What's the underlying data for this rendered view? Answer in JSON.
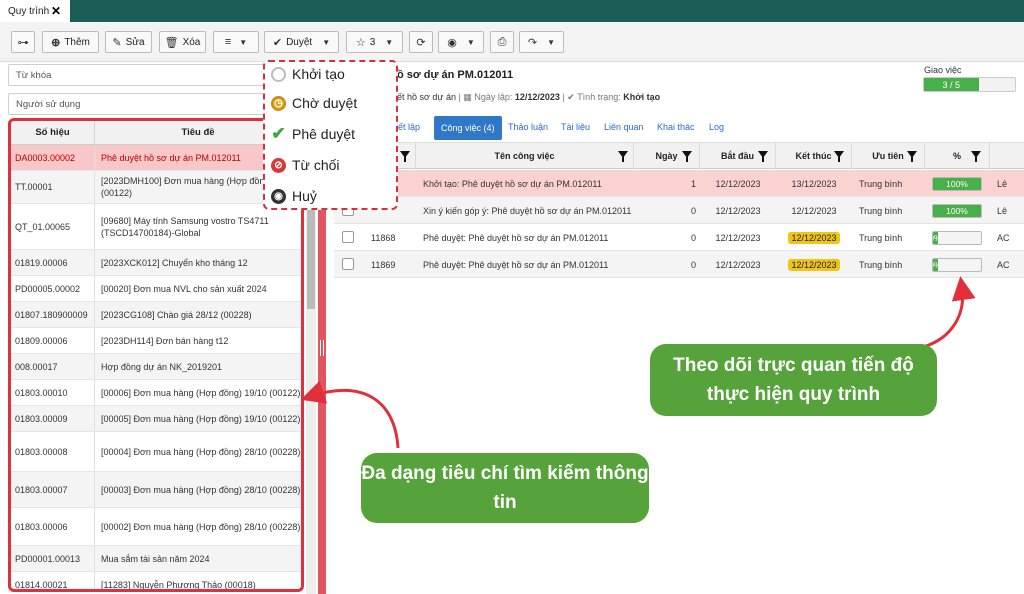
{
  "window": {
    "tab_label": "Quy trình",
    "close_glyph": "✕"
  },
  "toolbar": {
    "search_icon": "binoculars-icon",
    "add_label": "Thêm",
    "edit_label": "Sửa",
    "delete_label": "Xóa",
    "approve_label": "Duyệt",
    "star_count": "3"
  },
  "filters": {
    "keyword_placeholder": "Từ khóa",
    "user_placeholder": "Người sử dụng"
  },
  "left_table": {
    "headers": [
      "Số hiệu",
      "Tiêu đề"
    ],
    "rows": [
      {
        "id": "DA0003.00002",
        "title": "Phê duyệt hồ sơ dự án PM.012011"
      },
      {
        "id": "TT.00001",
        "title": "[2023DMH100] Đơn mua hàng (Hợp đồng) (00122)"
      },
      {
        "id": "QT_01.00065",
        "title": "[09680] Máy tính Samsung vostro TS4711 (TSCD14700184)-Global"
      },
      {
        "id": "01819.00006",
        "title": "[2023XCK012] Chuyển kho tháng 12"
      },
      {
        "id": "PD00005.00002",
        "title": "[00020] Đơn mua NVL cho sản xuất 2024"
      },
      {
        "id": "01807.180900009",
        "title": "[2023CG108] Chào giá 28/12 (00228)"
      },
      {
        "id": "01809.00006",
        "title": "[2023DH114] Đơn bán hàng t12"
      },
      {
        "id": "008.00017",
        "title": "Hợp đồng dự án NK_2019201"
      },
      {
        "id": "01803.00010",
        "title": "[00006] Đơn mua hàng (Hợp đồng) 19/10 (00122)"
      },
      {
        "id": "01803.00009",
        "title": "[00005] Đơn mua hàng (Hợp đồng) 19/10 (00122)"
      },
      {
        "id": "01803.00008",
        "title": "[00004] Đơn mua hàng (Hợp đồng) 28/10 (00228)"
      },
      {
        "id": "01803.00007",
        "title": "[00003] Đơn mua hàng (Hợp đồng) 28/10 (00228)"
      },
      {
        "id": "01803.00006",
        "title": "[00002] Đơn mua hàng (Hợp đồng) 28/10 (00228)"
      },
      {
        "id": "PD00001.00013",
        "title": "Mua sắm tài sản năm 2024"
      },
      {
        "id": "01814.00021",
        "title": "[11283] Nguyễn Phương Thảo (00018)"
      }
    ]
  },
  "detail": {
    "title": "ồ sơ dự án PM.012011",
    "meta_doc": "ết hồ sơ dự án",
    "meta_date_label": "Ngày lập:",
    "meta_date": "12/12/2023",
    "meta_status_label": "Tình trạng:",
    "meta_status": "Khởi tạo",
    "assign_label": "Giao việc",
    "assign_progress": "3 / 5",
    "assign_fraction": 0.6
  },
  "tabs": [
    "iết lập",
    "Công việc (4)",
    "Thảo luận",
    "Tài liệu",
    "Liên quan",
    "Khai thác",
    "Log"
  ],
  "grid": {
    "headers": {
      "name": "Tên công việc",
      "days": "Ngày",
      "start": "Bắt đầu",
      "end": "Kết thúc",
      "priority": "Ưu tiên",
      "percent": "%"
    },
    "rows": [
      {
        "code": "",
        "name": "Khởi tạo: Phê duyệt hồ sơ dự án PM.012011",
        "days": "1",
        "start": "12/12/2023",
        "end": "13/12/2023",
        "priority": "Trung bình",
        "percent": "100%",
        "percent_value": 100,
        "extra": "Lê"
      },
      {
        "code": "",
        "name": "Xin ý kiến góp ý: Phê duyệt hồ sơ dự án PM.012011",
        "days": "0",
        "start": "12/12/2023",
        "end": "12/12/2023",
        "priority": "Trung bình",
        "percent": "100%",
        "percent_value": 100,
        "extra": "Lê"
      },
      {
        "code": "11868",
        "name": "Phê duyệt: Phê duyệt hồ sơ dự án PM.012011",
        "days": "0",
        "start": "12/12/2023",
        "end": "12/12/2023",
        "priority": "Trung bình",
        "percent": "0%",
        "percent_value": 0,
        "extra": "AC"
      },
      {
        "code": "11869",
        "name": "Phê duyệt: Phê duyệt hồ sơ dự án PM.012011",
        "days": "0",
        "start": "12/12/2023",
        "end": "12/12/2023",
        "priority": "Trung bình",
        "percent": "0%",
        "percent_value": 0,
        "extra": "AC"
      }
    ]
  },
  "status_menu": [
    {
      "label": "Khởi tạo",
      "icon": "circle-grey-icon",
      "color": "#bdbdbd"
    },
    {
      "label": "Chờ duyệt",
      "icon": "clock-yellow-icon",
      "color": "#e5a81c"
    },
    {
      "label": "Phê duyệt",
      "icon": "check-green-icon",
      "color": "#39a845"
    },
    {
      "label": "Từ chối",
      "icon": "ban-red-icon",
      "color": "#d83a3a"
    },
    {
      "label": "Huỷ",
      "icon": "stop-dark-icon",
      "color": "#333333"
    }
  ],
  "callouts": {
    "search": "Đa dạng tiêu chí tìm kiếm thông tin",
    "progress": "Theo dõi trực quan tiến độ thực hiện quy trình"
  },
  "colors": {
    "header_bar": "#1b5e57",
    "accent_red": "#e0303c",
    "callout_green": "#57a33b",
    "tab_active": "#2f78c8",
    "progress_green": "#48b04b",
    "date_highlight": "#f0c419"
  }
}
